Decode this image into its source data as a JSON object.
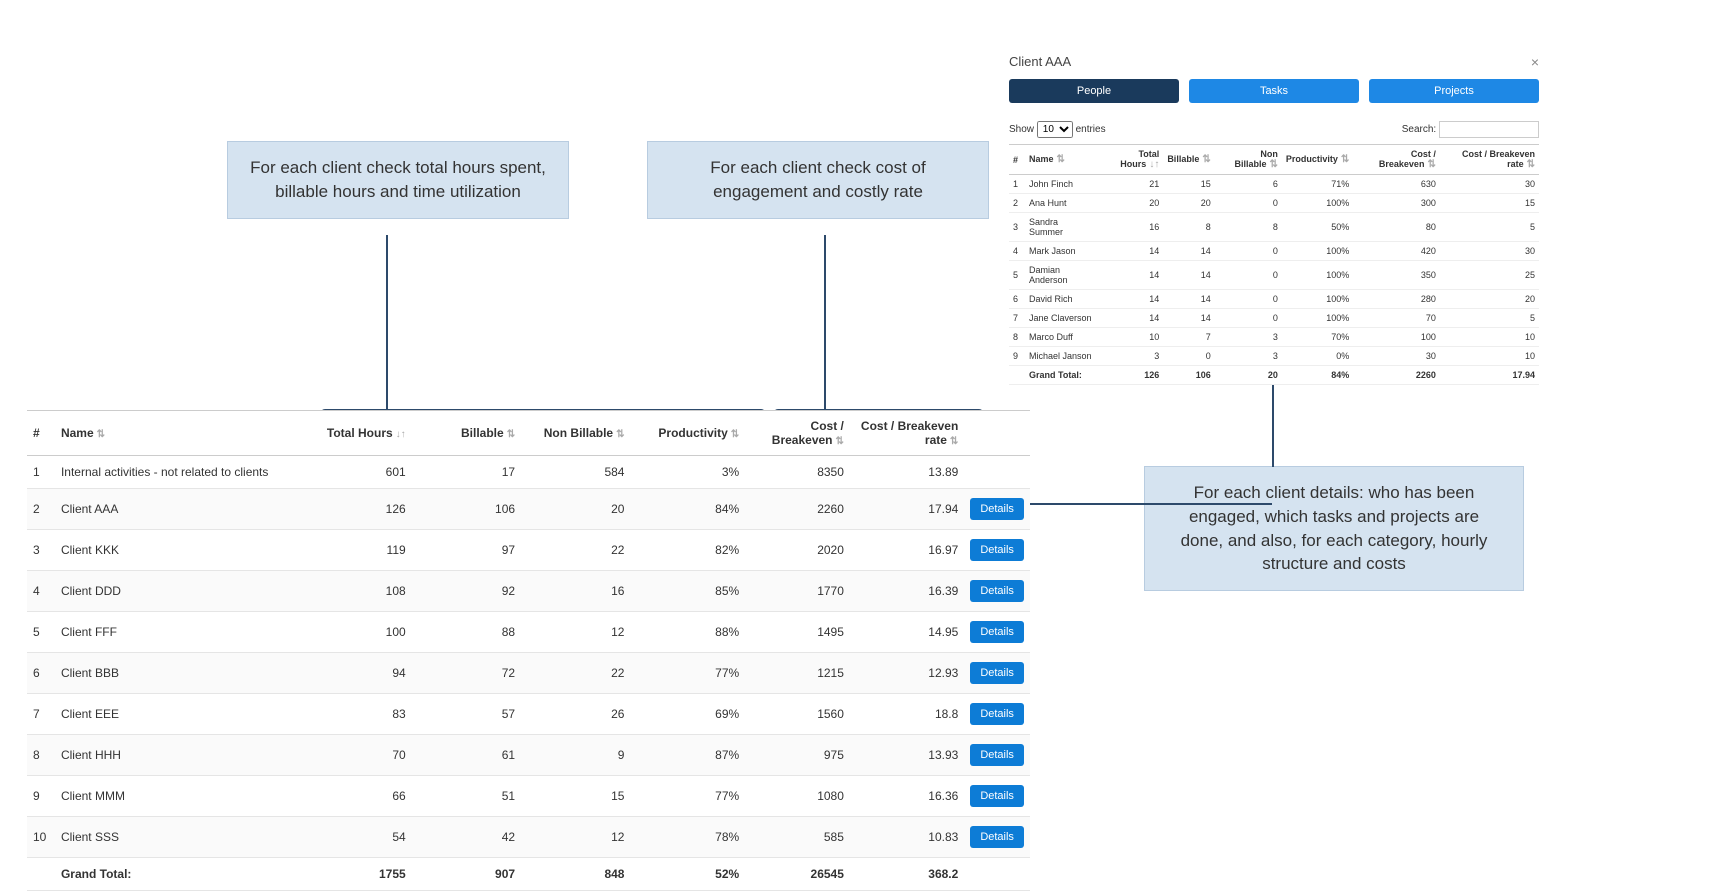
{
  "callouts": {
    "c1": "For each client check total hours spent, billable hours and time utilization",
    "c2": "For each client check cost of engagement and costly rate",
    "c3": "For each client details: who has been engaged, which tasks and projects are done, and also, for each category, hourly structure and costs"
  },
  "main": {
    "headers": {
      "idx": "#",
      "name": "Name",
      "total": "Total Hours",
      "billable": "Billable",
      "nonbillable": "Non Billable",
      "productivity": "Productivity",
      "costbe": "Cost / Breakeven",
      "costberate": "Cost / Breakeven rate"
    },
    "rows": [
      {
        "idx": "1",
        "name": "Internal activities - not related to clients",
        "total": "601",
        "billable": "17",
        "nonbillable": "584",
        "productivity": "3%",
        "costbe": "8350",
        "costberate": "13.89"
      },
      {
        "idx": "2",
        "name": "Client AAA",
        "total": "126",
        "billable": "106",
        "nonbillable": "20",
        "productivity": "84%",
        "costbe": "2260",
        "costberate": "17.94"
      },
      {
        "idx": "3",
        "name": "Client KKK",
        "total": "119",
        "billable": "97",
        "nonbillable": "22",
        "productivity": "82%",
        "costbe": "2020",
        "costberate": "16.97"
      },
      {
        "idx": "4",
        "name": "Client DDD",
        "total": "108",
        "billable": "92",
        "nonbillable": "16",
        "productivity": "85%",
        "costbe": "1770",
        "costberate": "16.39"
      },
      {
        "idx": "5",
        "name": "Client FFF",
        "total": "100",
        "billable": "88",
        "nonbillable": "12",
        "productivity": "88%",
        "costbe": "1495",
        "costberate": "14.95"
      },
      {
        "idx": "6",
        "name": "Client BBB",
        "total": "94",
        "billable": "72",
        "nonbillable": "22",
        "productivity": "77%",
        "costbe": "1215",
        "costberate": "12.93"
      },
      {
        "idx": "7",
        "name": "Client EEE",
        "total": "83",
        "billable": "57",
        "nonbillable": "26",
        "productivity": "69%",
        "costbe": "1560",
        "costberate": "18.8"
      },
      {
        "idx": "8",
        "name": "Client HHH",
        "total": "70",
        "billable": "61",
        "nonbillable": "9",
        "productivity": "87%",
        "costbe": "975",
        "costberate": "13.93"
      },
      {
        "idx": "9",
        "name": "Client MMM",
        "total": "66",
        "billable": "51",
        "nonbillable": "15",
        "productivity": "77%",
        "costbe": "1080",
        "costberate": "16.36"
      },
      {
        "idx": "10",
        "name": "Client SSS",
        "total": "54",
        "billable": "42",
        "nonbillable": "12",
        "productivity": "78%",
        "costbe": "585",
        "costberate": "10.83"
      }
    ],
    "footer_label": "Grand Total:",
    "footer": {
      "total": "1755",
      "billable": "907",
      "nonbillable": "848",
      "productivity": "52%",
      "costbe": "26545",
      "costberate": "368.2"
    },
    "details_btn": "Details"
  },
  "detail": {
    "title": "Client AAA",
    "tabs": {
      "people": "People",
      "tasks": "Tasks",
      "projects": "Projects"
    },
    "show_label": "Show",
    "entries_label": "entries",
    "page_size": "10",
    "search_label": "Search:",
    "headers": {
      "idx": "#",
      "name": "Name",
      "total": "Total Hours",
      "billable": "Billable",
      "nonbillable": "Non Billable",
      "productivity": "Productivity",
      "costbe": "Cost / Breakeven",
      "costberate": "Cost / Breakeven rate"
    },
    "rows": [
      {
        "idx": "1",
        "name": "John Finch",
        "total": "21",
        "billable": "15",
        "nonbillable": "6",
        "productivity": "71%",
        "costbe": "630",
        "costberate": "30"
      },
      {
        "idx": "2",
        "name": "Ana Hunt",
        "total": "20",
        "billable": "20",
        "nonbillable": "0",
        "productivity": "100%",
        "costbe": "300",
        "costberate": "15"
      },
      {
        "idx": "3",
        "name": "Sandra Summer",
        "total": "16",
        "billable": "8",
        "nonbillable": "8",
        "productivity": "50%",
        "costbe": "80",
        "costberate": "5"
      },
      {
        "idx": "4",
        "name": "Mark Jason",
        "total": "14",
        "billable": "14",
        "nonbillable": "0",
        "productivity": "100%",
        "costbe": "420",
        "costberate": "30"
      },
      {
        "idx": "5",
        "name": "Damian Anderson",
        "total": "14",
        "billable": "14",
        "nonbillable": "0",
        "productivity": "100%",
        "costbe": "350",
        "costberate": "25"
      },
      {
        "idx": "6",
        "name": "David Rich",
        "total": "14",
        "billable": "14",
        "nonbillable": "0",
        "productivity": "100%",
        "costbe": "280",
        "costberate": "20"
      },
      {
        "idx": "7",
        "name": "Jane Claverson",
        "total": "14",
        "billable": "14",
        "nonbillable": "0",
        "productivity": "100%",
        "costbe": "70",
        "costberate": "5"
      },
      {
        "idx": "8",
        "name": "Marco Duff",
        "total": "10",
        "billable": "7",
        "nonbillable": "3",
        "productivity": "70%",
        "costbe": "100",
        "costberate": "10"
      },
      {
        "idx": "9",
        "name": "Michael Janson",
        "total": "3",
        "billable": "0",
        "nonbillable": "3",
        "productivity": "0%",
        "costbe": "30",
        "costberate": "10"
      }
    ],
    "footer_label": "Grand Total:",
    "footer": {
      "total": "126",
      "billable": "106",
      "nonbillable": "20",
      "productivity": "84%",
      "costbe": "2260",
      "costberate": "17.94"
    }
  }
}
